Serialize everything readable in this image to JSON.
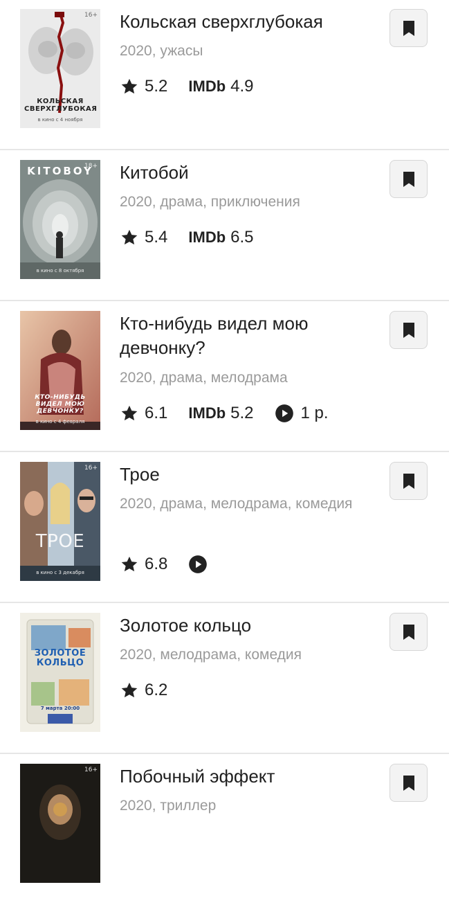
{
  "movies": [
    {
      "title": "Кольская сверхглубокая",
      "meta": "2020, ужасы",
      "rating": "5.2",
      "imdb_label": "IMDb",
      "imdb": "4.9",
      "poster": {
        "title": "Кольская сверхглубокая",
        "note": "в кино с 4 ноября",
        "age": "16+"
      }
    },
    {
      "title": "Китобой",
      "meta": "2020, драма, приключения",
      "rating": "5.4",
      "imdb_label": "IMDb",
      "imdb": "6.5",
      "poster": {
        "title": "Kitoboy",
        "note": "в кино с 8 октября",
        "age": "18+"
      }
    },
    {
      "title": "Кто-нибудь видел мою девчонку?",
      "meta": "2020, драма, мелодрама",
      "rating": "6.1",
      "imdb_label": "IMDb",
      "imdb": "5.2",
      "price": "1 р.",
      "poster": {
        "title": "Кто-нибудь видел мою девчонку?",
        "note": "в кино с 4 февраля",
        "age": ""
      }
    },
    {
      "title": "Трое",
      "meta": "2020, драма, мелодрама, комедия",
      "rating": "6.8",
      "poster": {
        "title": "Трое",
        "note": "в кино с 3 декабря",
        "age": "16+"
      }
    },
    {
      "title": "Золотое кольцо",
      "meta": "2020, мелодрама, комедия",
      "rating": "6.2",
      "poster": {
        "title": "Золотое кольцо",
        "note": "7 марта 20:00",
        "age": ""
      }
    },
    {
      "title": "Побочный эффект",
      "meta": "2020, триллер",
      "poster": {
        "title": "",
        "note": "",
        "age": "16+"
      }
    }
  ],
  "colors": {
    "title_text": "#202020",
    "meta_text": "#9a9a9a",
    "divider": "#e6e6e6",
    "bookmark_bg": "#f3f3f3",
    "icon": "#222222"
  },
  "icons": {
    "rating": "star-icon",
    "online": "play-circle-icon",
    "bookmark": "bookmark-icon"
  }
}
